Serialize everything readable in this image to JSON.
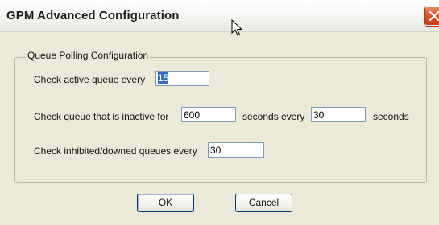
{
  "window": {
    "title": "GPM Advanced Configuration"
  },
  "group": {
    "label": "Queue Polling Configuration"
  },
  "active_queue": {
    "label": "Check active queue every",
    "value": "15"
  },
  "inactive_queue": {
    "label_prefix": "Check queue that is inactive for",
    "inactive_value": "600",
    "label_middle": "seconds every",
    "interval_value": "30",
    "label_suffix": "seconds"
  },
  "inhibited_queue": {
    "label": "Check inhibited/downed queues every",
    "value": "30"
  },
  "buttons": {
    "ok": "OK",
    "cancel": "Cancel"
  },
  "icons": {
    "close": "close-icon",
    "cursor": "cursor-icon"
  },
  "colors": {
    "selection": "#316ac5",
    "close_button": "#d5512d",
    "dialog_background": "#ece9d8"
  }
}
